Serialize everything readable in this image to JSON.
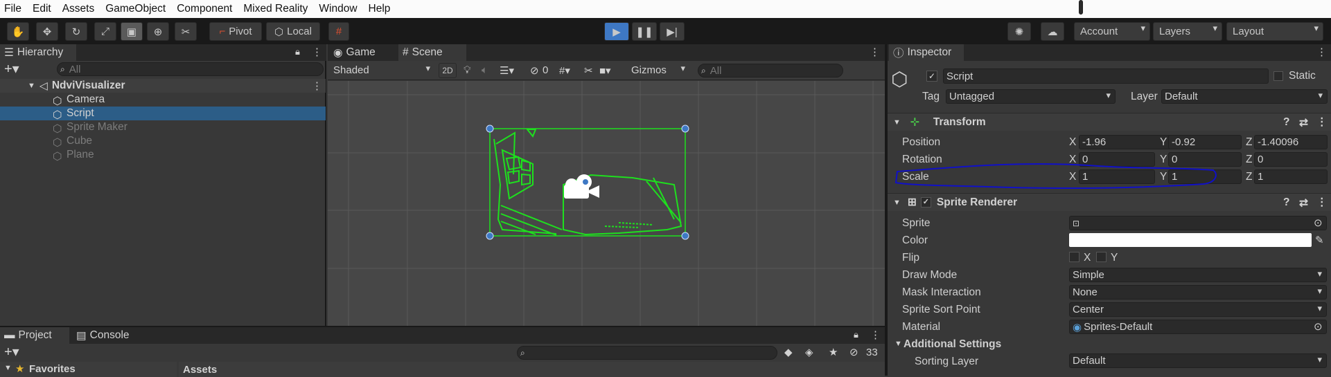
{
  "menu": [
    "File",
    "Edit",
    "Assets",
    "GameObject",
    "Component",
    "Mixed Reality",
    "Window",
    "Help"
  ],
  "toolbar": {
    "pivot": "Pivot",
    "local": "Local",
    "account": "Account",
    "layers": "Layers",
    "layout": "Layout"
  },
  "hierarchy": {
    "title": "Hierarchy",
    "search_placeholder": "All",
    "root": "NdviVisualizer",
    "items": [
      {
        "label": "Camera",
        "active": true,
        "selected": false
      },
      {
        "label": "Script",
        "active": true,
        "selected": true
      },
      {
        "label": "Sprite Maker",
        "active": false,
        "selected": false
      },
      {
        "label": "Cube",
        "active": false,
        "selected": false
      },
      {
        "label": "Plane",
        "active": false,
        "selected": false
      }
    ]
  },
  "scene": {
    "tab_game": "Game",
    "tab_scene": "Scene",
    "shading": "Shaded",
    "mode_2d": "2D",
    "hidden_count": "0",
    "gizmos": "Gizmos",
    "search_placeholder": "All"
  },
  "project": {
    "tab_project": "Project",
    "tab_console": "Console",
    "count": "33",
    "favorites": "Favorites",
    "assets": "Assets"
  },
  "inspector": {
    "title": "Inspector",
    "object_name": "Script",
    "static_label": "Static",
    "tag_label": "Tag",
    "tag_value": "Untagged",
    "layer_label": "Layer",
    "layer_value": "Default",
    "transform": {
      "title": "Transform",
      "position": {
        "label": "Position",
        "x": "-1.96",
        "y": "-0.92",
        "z": "-1.40096"
      },
      "rotation": {
        "label": "Rotation",
        "x": "0",
        "y": "0",
        "z": "0"
      },
      "scale": {
        "label": "Scale",
        "x": "1",
        "y": "1",
        "z": "1"
      }
    },
    "sprite_renderer": {
      "title": "Sprite Renderer",
      "sprite_label": "Sprite",
      "color_label": "Color",
      "flip_label": "Flip",
      "flip_x": "X",
      "flip_y": "Y",
      "draw_mode_label": "Draw Mode",
      "draw_mode": "Simple",
      "mask_label": "Mask Interaction",
      "mask": "None",
      "sort_point_label": "Sprite Sort Point",
      "sort_point": "Center",
      "material_label": "Material",
      "material": "Sprites-Default",
      "additional": "Additional Settings",
      "sorting_layer_label": "Sorting Layer",
      "sorting_layer": "Default"
    }
  },
  "colors": {
    "accent": "#3e78c4",
    "selection": "#2c5d87",
    "scene_bg": "#474747",
    "outline_green": "#1ee01e",
    "annotation": "#1010c8"
  }
}
